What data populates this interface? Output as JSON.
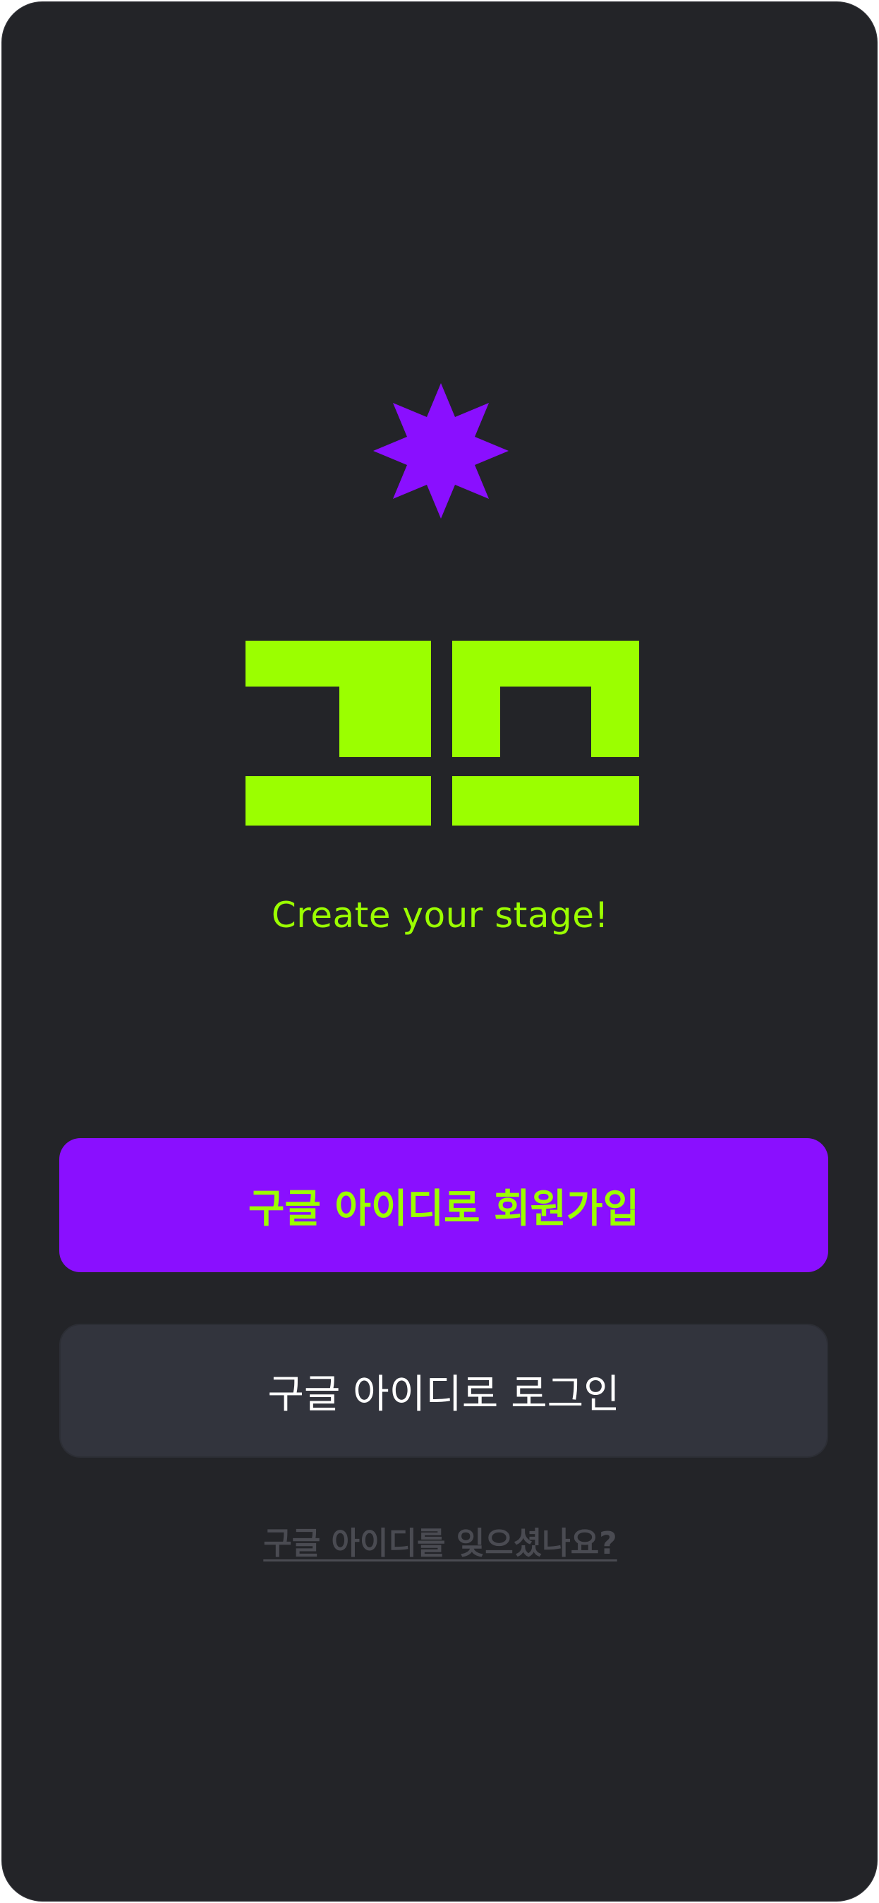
{
  "brand": {
    "star_icon": "eight-point-star-icon",
    "logo_icon": "zm-block-logo",
    "tagline": "Create your stage!"
  },
  "actions": {
    "signup_label": "구글 아이디로 회원가입",
    "login_label": "구글 아이디로 로그인",
    "forgot_label": "구글 아이디를 잊으셨나요?"
  },
  "colors": {
    "background": "#232428",
    "accent_purple": "#8a0fff",
    "accent_lime": "#9bff00",
    "secondary_button": "#32343d",
    "muted_link": "#4a4b52"
  }
}
